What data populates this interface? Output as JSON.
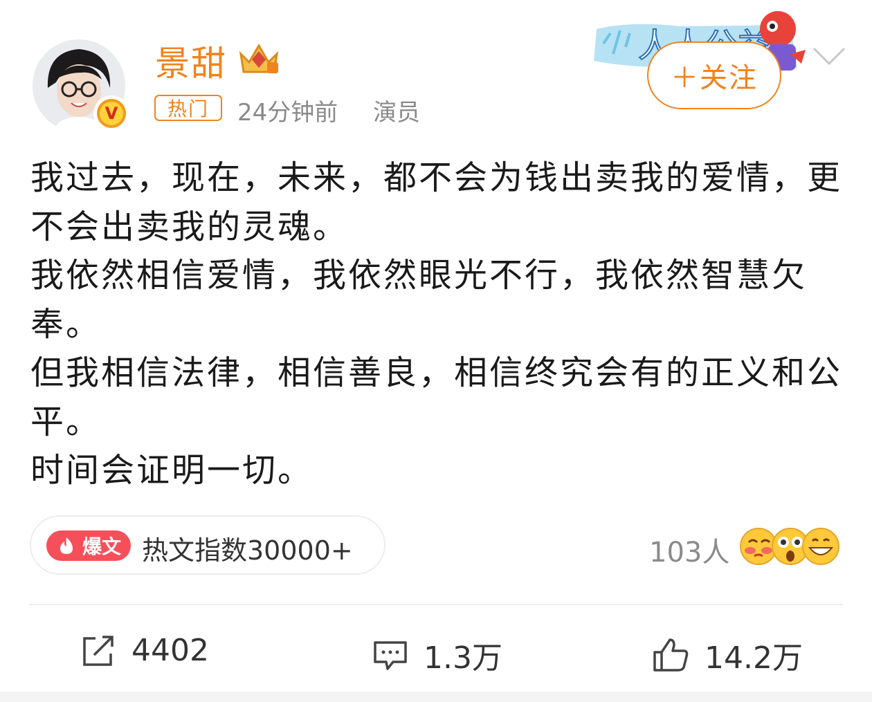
{
  "user": {
    "name": "景甜",
    "hot_tag": "热门",
    "time": "24分钟前",
    "role": "演员"
  },
  "header": {
    "follow_label": "＋关注",
    "banner_text": "人人公益"
  },
  "post": {
    "lines": [
      "我过去，现在，未来，都不会为钱出卖我的爱情，更不会出卖我的灵魂。",
      "我依然相信爱情，我依然眼光不行，我依然智慧欠奉。",
      "但我相信法律，相信善良，相信终究会有的正义和公平。",
      "时间会证明一切。"
    ]
  },
  "hot": {
    "badge": "爆文",
    "index_text": "热文指数30000+"
  },
  "reactions": {
    "count_label": "103人",
    "emojis": [
      "blush-kiss-icon",
      "surprised-icon",
      "grin-icon"
    ]
  },
  "actions": {
    "repost": "4402",
    "comment": "1.3万",
    "like": "14.2万"
  },
  "colors": {
    "accent": "#f0831e",
    "hot_badge": "#f5505a",
    "meta": "#8a8a8a"
  }
}
